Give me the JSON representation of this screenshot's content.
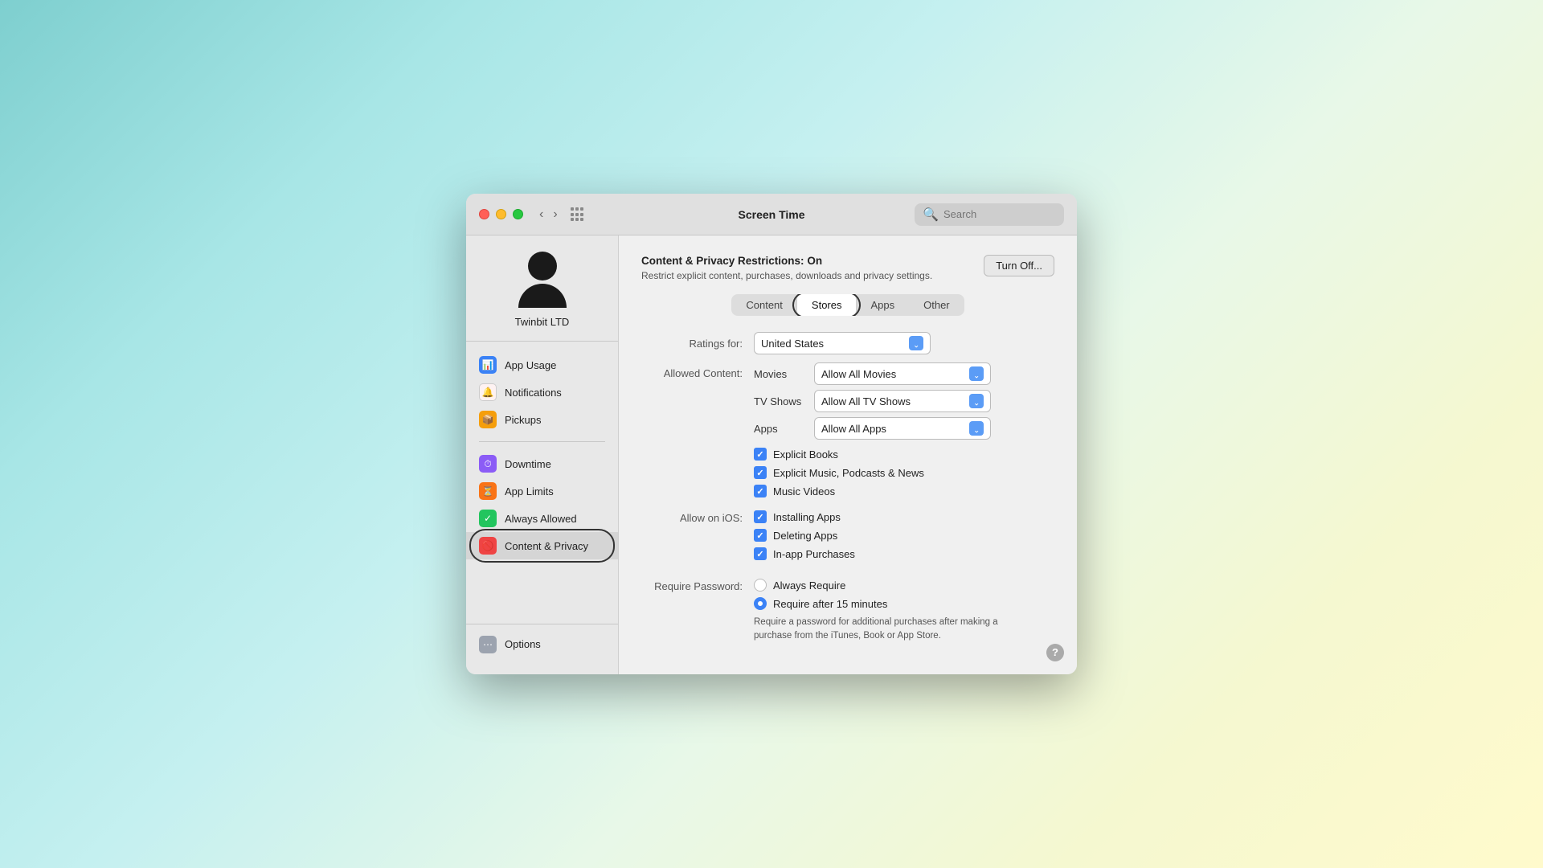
{
  "window": {
    "title": "Screen Time"
  },
  "search": {
    "placeholder": "Search"
  },
  "sidebar": {
    "username": "Twinbit LTD",
    "items_group1": [
      {
        "id": "app-usage",
        "label": "App Usage",
        "icon": "bar-chart-icon",
        "color": "blue"
      },
      {
        "id": "notifications",
        "label": "Notifications",
        "icon": "bell-icon",
        "color": "red-outline"
      },
      {
        "id": "pickups",
        "label": "Pickups",
        "icon": "pickup-icon",
        "color": "yellow"
      }
    ],
    "items_group2": [
      {
        "id": "downtime",
        "label": "Downtime",
        "icon": "downtime-icon",
        "color": "purple"
      },
      {
        "id": "app-limits",
        "label": "App Limits",
        "icon": "timer-icon",
        "color": "orange"
      },
      {
        "id": "always-allowed",
        "label": "Always Allowed",
        "icon": "check-icon",
        "color": "green"
      },
      {
        "id": "content-privacy",
        "label": "Content & Privacy",
        "icon": "block-icon",
        "color": "red",
        "active": true
      }
    ],
    "options_label": "Options"
  },
  "main": {
    "restrictions_title": "Content & Privacy Restrictions:",
    "restrictions_status": "On",
    "restrictions_desc": "Restrict explicit content, purchases, downloads and privacy settings.",
    "turn_off_label": "Turn Off...",
    "tabs": [
      {
        "id": "content",
        "label": "Content"
      },
      {
        "id": "stores",
        "label": "Stores",
        "active": true
      },
      {
        "id": "apps",
        "label": "Apps"
      },
      {
        "id": "other",
        "label": "Other"
      }
    ],
    "ratings_for_label": "Ratings for:",
    "ratings_for_value": "United States",
    "allowed_content_label": "Allowed Content:",
    "movies_label": "Movies",
    "movies_value": "Allow All Movies",
    "tv_shows_label": "TV Shows",
    "tv_shows_value": "Allow All TV Shows",
    "apps_label": "Apps",
    "apps_value": "Allow All Apps",
    "checkboxes": [
      {
        "id": "explicit-books",
        "label": "Explicit Books",
        "checked": true
      },
      {
        "id": "explicit-music",
        "label": "Explicit Music, Podcasts & News",
        "checked": true
      },
      {
        "id": "music-videos",
        "label": "Music Videos",
        "checked": true
      }
    ],
    "allow_on_ios_label": "Allow on iOS:",
    "ios_items": [
      {
        "id": "installing-apps",
        "label": "Installing Apps",
        "checked": true
      },
      {
        "id": "deleting-apps",
        "label": "Deleting Apps",
        "checked": true
      },
      {
        "id": "inapp-purchases",
        "label": "In-app Purchases",
        "checked": true
      }
    ],
    "require_password_label": "Require Password:",
    "password_options": [
      {
        "id": "always-require",
        "label": "Always Require",
        "checked": false
      },
      {
        "id": "require-15min",
        "label": "Require after 15 minutes",
        "checked": true
      }
    ],
    "require_note": "Require a password for additional purchases after making a purchase from the iTunes, Book or App Store."
  },
  "icons": {
    "search": "🔍",
    "bar-chart": "📊",
    "bell": "🔔",
    "pickup": "📦",
    "downtime": "⏱",
    "timer": "⏳",
    "check": "✓",
    "block": "🚫",
    "options": "⋯",
    "help": "?"
  }
}
